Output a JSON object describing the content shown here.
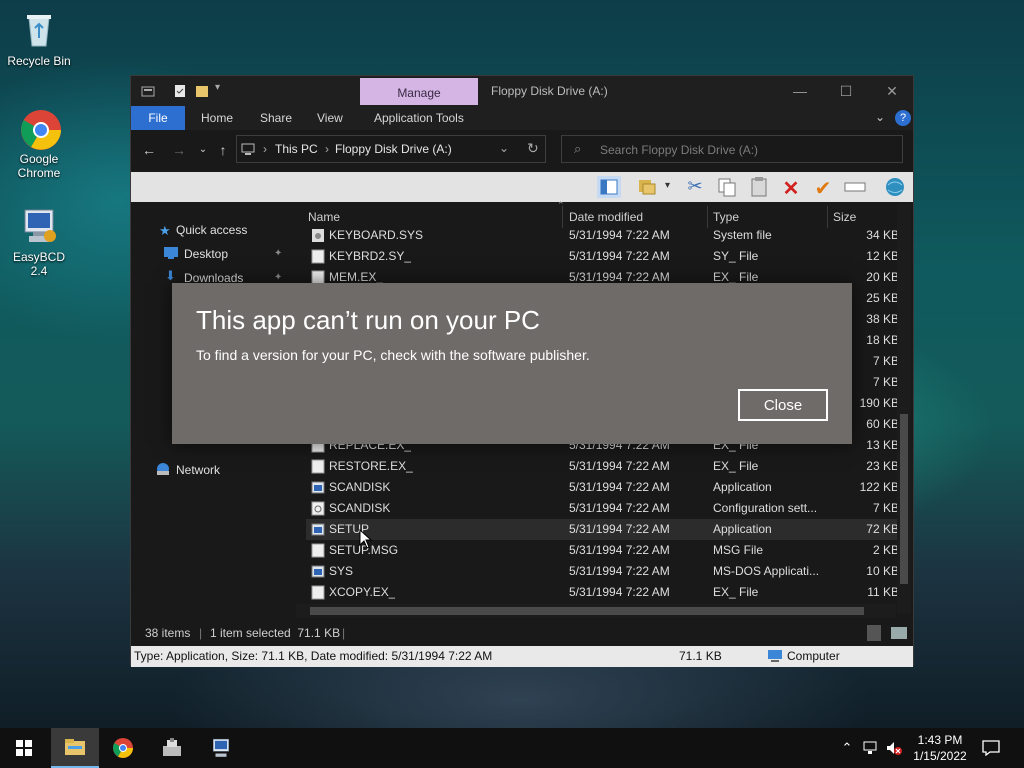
{
  "desktop": {
    "icons": [
      {
        "label": "Recycle Bin"
      },
      {
        "label": "Google Chrome"
      },
      {
        "label": "EasyBCD 2.4"
      }
    ]
  },
  "window": {
    "manage_tab": "Manage",
    "title": "Floppy Disk Drive (A:)",
    "ribbon_tabs": [
      "File",
      "Home",
      "Share",
      "View",
      "Application Tools"
    ],
    "breadcrumb": [
      "This PC",
      "Floppy Disk Drive (A:)"
    ],
    "search_placeholder": "Search Floppy Disk Drive (A:)"
  },
  "nav_pane": {
    "items": [
      "Quick access",
      "Desktop",
      "Downloads",
      "Network"
    ]
  },
  "columns": {
    "name": "Name",
    "date": "Date modified",
    "type": "Type",
    "size": "Size"
  },
  "files": [
    {
      "name": "KEYBOARD.SYS",
      "date": "5/31/1994 7:22 AM",
      "type": "System file",
      "size": "34 KB"
    },
    {
      "name": "KEYBRD2.SY_",
      "date": "5/31/1994 7:22 AM",
      "type": "SY_ File",
      "size": "12 KB"
    },
    {
      "name": "MEM.EX_",
      "date": "5/31/1994 7:22 AM",
      "type": "EX_ File",
      "size": "20 KB"
    },
    {
      "name": "REPLACE.EX_",
      "date": "5/31/1994 7:22 AM",
      "type": "EX_ File",
      "size": "13 KB"
    },
    {
      "name": "RESTORE.EX_",
      "date": "5/31/1994 7:22 AM",
      "type": "EX_ File",
      "size": "23 KB"
    },
    {
      "name": "SCANDISK",
      "date": "5/31/1994 7:22 AM",
      "type": "Application",
      "size": "122 KB"
    },
    {
      "name": "SCANDISK",
      "date": "5/31/1994 7:22 AM",
      "type": "Configuration sett...",
      "size": "7 KB"
    },
    {
      "name": "SETUP",
      "date": "5/31/1994 7:22 AM",
      "type": "Application",
      "size": "72 KB"
    },
    {
      "name": "SETUP.MSG",
      "date": "5/31/1994 7:22 AM",
      "type": "MSG File",
      "size": "2 KB"
    },
    {
      "name": "SYS",
      "date": "5/31/1994 7:22 AM",
      "type": "MS-DOS Applicati...",
      "size": "10 KB"
    },
    {
      "name": "XCOPY.EX_",
      "date": "5/31/1994 7:22 AM",
      "type": "EX_ File",
      "size": "11 KB"
    }
  ],
  "partial_sizes": [
    "25 KB",
    "38 KB",
    "18 KB",
    "7 KB",
    "7 KB",
    "190 KB",
    "60 KB"
  ],
  "status": {
    "items": "38 items",
    "selected": "1 item selected  71.1 KB",
    "info": "Type: Application, Size: 71.1 KB, Date modified: 5/31/1994 7:22 AM",
    "info_size": "71.1 KB",
    "info_location": "Computer"
  },
  "dialog": {
    "title": "This app can’t run on your PC",
    "message": "To find a version for your PC, check with the software publisher.",
    "close_label": "Close"
  },
  "taskbar": {
    "time": "1:43 PM",
    "date": "1/15/2022"
  }
}
